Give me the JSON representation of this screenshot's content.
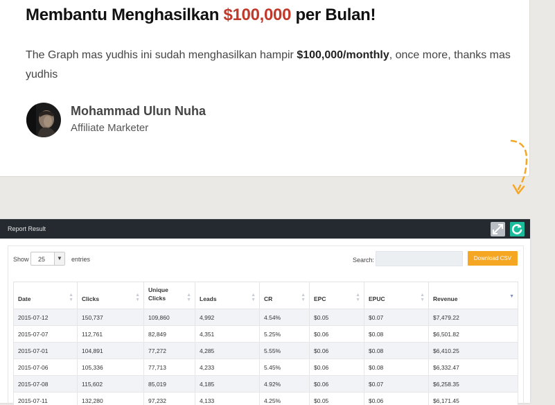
{
  "testimonial": {
    "headline_pre": "Membantu Menghasilkan ",
    "headline_amount": "$100,000",
    "headline_post": " per Bulan!",
    "quote_pre": "The Graph mas yudhis ini sudah menghasilkan hampir ",
    "quote_bold": "$100,000/monthly",
    "quote_post": ", once more, thanks mas yudhis",
    "author_name": "Mohammad Ulun Nuha",
    "author_role": "Affiliate Marketer",
    "accent_color": "#c0392b",
    "arrow_color": "#f5a623"
  },
  "report": {
    "title": "Report Result",
    "expand_icon": "expand-icon",
    "refresh_icon": "refresh-icon",
    "show_label": "Show",
    "entries_value": "25",
    "entries_label": "entries",
    "search_label": "Search:",
    "search_value": "",
    "csv_button": "Download CSV",
    "button_color": "#f5a623",
    "header_color": "#252a30",
    "columns": [
      {
        "label": "Date",
        "sorted": false
      },
      {
        "label": "Clicks",
        "sorted": false
      },
      {
        "label": "Unique Clicks",
        "sorted": false
      },
      {
        "label": "Leads",
        "sorted": false
      },
      {
        "label": "CR",
        "sorted": false
      },
      {
        "label": "EPC",
        "sorted": false
      },
      {
        "label": "EPUC",
        "sorted": false
      },
      {
        "label": "Revenue",
        "sorted": true
      }
    ],
    "rows": [
      [
        "2015-07-12",
        "150,737",
        "109,860",
        "4,992",
        "4.54%",
        "$0.05",
        "$0.07",
        "$7,479.22"
      ],
      [
        "2015-07-07",
        "112,761",
        "82,849",
        "4,351",
        "5.25%",
        "$0.06",
        "$0.08",
        "$6,501.82"
      ],
      [
        "2015-07-01",
        "104,891",
        "77,272",
        "4,285",
        "5.55%",
        "$0.06",
        "$0.08",
        "$6,410.25"
      ],
      [
        "2015-07-06",
        "105,336",
        "77,713",
        "4,233",
        "5.45%",
        "$0.06",
        "$0.08",
        "$6,332.47"
      ],
      [
        "2015-07-08",
        "115,602",
        "85,019",
        "4,185",
        "4.92%",
        "$0.06",
        "$0.07",
        "$6,258.35"
      ],
      [
        "2015-07-11",
        "132,280",
        "97,232",
        "4,133",
        "4.25%",
        "$0.05",
        "$0.06",
        "$6,171.45"
      ]
    ]
  }
}
